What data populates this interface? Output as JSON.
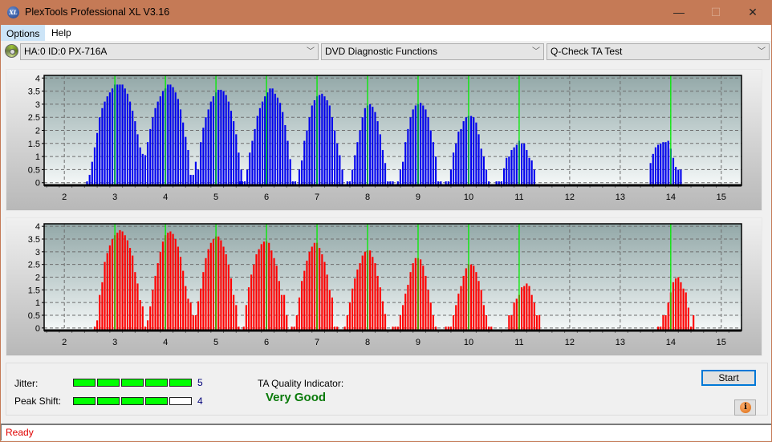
{
  "window": {
    "title": "PlexTools Professional XL V3.16",
    "app_icon_text": "XL",
    "minimize_glyph": "—",
    "maximize_glyph": "☐",
    "close_glyph": "✕"
  },
  "menu": {
    "items": [
      {
        "label": "Options"
      },
      {
        "label": "Help"
      }
    ]
  },
  "toolbar": {
    "drive_select": "HA:0 ID:0  PX-716A",
    "function_select": "DVD Diagnostic Functions",
    "test_select": "Q-Check TA Test",
    "chevron": "﹀"
  },
  "colors": {
    "top_bars": "#0000ee",
    "bottom_bars": "#ff0000",
    "marker": "#00ee00",
    "quality_text": "#0a7a0a"
  },
  "chart_data": [
    {
      "type": "bar",
      "name": "TA distribution (upper, land)",
      "xlim": [
        1.6,
        15.4
      ],
      "ylim": [
        -0.1,
        4.1
      ],
      "x_ticks": [
        2,
        3,
        4,
        5,
        6,
        7,
        8,
        9,
        10,
        11,
        12,
        13,
        14,
        15
      ],
      "y_ticks": [
        "0",
        "0.5",
        "1",
        "1.5",
        "2",
        "2.5",
        "3",
        "3.5",
        "4"
      ],
      "y_tick_values": [
        0,
        0.5,
        1,
        1.5,
        2,
        2.5,
        3,
        3.5,
        4
      ],
      "grid": true,
      "markers": [
        3,
        4,
        5,
        6,
        7,
        8,
        9,
        10,
        11,
        14
      ],
      "series_color": "#0000ee",
      "bar_step": 0.05,
      "segments": [
        {
          "x0": 2.45,
          "values": [
            0.05,
            0.3,
            0.8,
            1.35,
            1.9,
            2.5,
            2.85,
            3.1,
            3.3,
            3.45,
            3.6,
            3.75,
            3.75,
            3.75,
            3.75,
            3.6,
            3.4,
            3.1,
            2.75,
            2.35,
            1.85,
            1.35,
            1.1,
            1.05,
            1.55,
            2.05,
            2.5,
            2.85,
            3.1,
            3.3,
            3.5,
            3.6,
            3.75,
            3.75,
            3.65,
            3.45,
            3.2,
            2.8,
            2.3,
            1.75,
            1.25,
            0.3,
            0.3,
            0.8,
            0.5,
            1.55,
            2.1,
            2.5,
            2.8,
            3.1,
            3.3,
            3.45,
            3.55,
            3.55,
            3.5,
            3.35,
            3.1,
            2.75,
            2.35,
            1.85,
            1.15,
            0.5
          ]
        },
        {
          "x0": 5.47,
          "values": [
            0.05,
            0.05,
            0.05,
            0.5,
            1.15,
            1.6,
            2.05,
            2.55,
            2.85,
            3.1,
            3.3,
            3.45,
            3.6,
            3.6,
            3.4,
            3.25,
            3.05,
            2.7,
            2.2,
            1.6,
            0.9,
            0.05,
            0.05
          ]
        },
        {
          "x0": 6.65,
          "values": [
            0.5,
            0.85,
            1.6,
            2.0,
            2.5,
            2.95,
            3.15,
            3.3,
            3.35,
            3.4,
            3.3,
            3.15,
            2.95,
            2.5,
            2.0,
            1.5,
            1.05,
            0.5
          ]
        },
        {
          "x0": 7.6,
          "values": [
            0.05,
            0.05,
            0.5,
            1.05,
            1.55,
            2.0,
            2.5,
            2.85,
            2.95,
            3.0,
            2.9,
            2.7,
            2.35,
            1.85,
            1.25,
            0.75,
            0.05,
            0.05,
            0.05
          ]
        },
        {
          "x0": 8.6,
          "values": [
            0.05,
            0.5,
            0.8,
            1.55,
            2.05,
            2.5,
            2.8,
            2.95,
            3.0,
            3.05,
            2.95,
            2.8,
            2.5,
            2.0,
            1.55,
            1.0,
            0.05,
            0.05
          ]
        },
        {
          "x0": 9.55,
          "values": [
            0.05,
            0.05,
            0.5,
            1.15,
            1.5,
            1.95,
            2.05,
            2.35,
            2.5,
            2.55,
            2.55,
            2.5,
            2.3,
            1.85,
            1.3,
            1.0,
            0.5,
            0.05
          ]
        },
        {
          "x0": 10.55,
          "values": [
            0.05,
            0.05,
            0.05,
            0.55,
            0.95,
            1.0,
            1.25,
            1.35,
            1.45,
            1.6,
            1.5,
            1.5,
            1.25,
            0.95,
            0.85,
            0.5
          ]
        },
        {
          "x0": 13.6,
          "values": [
            0.75,
            1.1,
            1.35,
            1.45,
            1.5,
            1.55,
            1.55,
            1.6,
            1.3,
            0.95,
            0.6,
            0.5,
            0.5
          ]
        }
      ]
    },
    {
      "type": "bar",
      "name": "TA distribution (lower, groove)",
      "xlim": [
        1.6,
        15.4
      ],
      "ylim": [
        -0.1,
        4.1
      ],
      "x_ticks": [
        2,
        3,
        4,
        5,
        6,
        7,
        8,
        9,
        10,
        11,
        12,
        13,
        14,
        15
      ],
      "y_ticks": [
        "0",
        "0.5",
        "1",
        "1.5",
        "2",
        "2.5",
        "3",
        "3.5",
        "4"
      ],
      "y_tick_values": [
        0,
        0.5,
        1,
        1.5,
        2,
        2.5,
        3,
        3.5,
        4
      ],
      "grid": true,
      "markers": [
        3,
        4,
        5,
        6,
        7,
        8,
        9,
        10,
        11,
        14
      ],
      "series_color": "#ff0000",
      "bar_step": 0.05,
      "segments": [
        {
          "x0": 2.6,
          "values": [
            0.05,
            0.3,
            1.3,
            1.8,
            2.6,
            2.95,
            3.25,
            3.5,
            3.65,
            3.75,
            3.85,
            3.8,
            3.65,
            3.45,
            3.15,
            2.85,
            2.2,
            1.75,
            1.1,
            0.85,
            0.05,
            0.3,
            0.85,
            1.5,
            2.05,
            2.55,
            3.0,
            3.4,
            3.65,
            3.75,
            3.8,
            3.7,
            3.5,
            3.2,
            2.8,
            2.25,
            1.65,
            1.15,
            1.0,
            0.5,
            0.5,
            1.05,
            1.55,
            2.2,
            2.75,
            3.1,
            3.35,
            3.5,
            3.6,
            3.6,
            3.45,
            3.2,
            2.9,
            2.5,
            1.95,
            1.3,
            0.9,
            0.05
          ]
        },
        {
          "x0": 5.55,
          "values": [
            0.05,
            0.9,
            1.6,
            2.1,
            2.5,
            2.9,
            3.1,
            3.3,
            3.4,
            3.4,
            3.35,
            3.05,
            2.75,
            2.45,
            1.85,
            1.3,
            1.3,
            0.5
          ]
        },
        {
          "x0": 6.5,
          "values": [
            0.05,
            0.05,
            0.5,
            1.2,
            1.85,
            2.25,
            2.65,
            3.0,
            3.2,
            3.35,
            3.35,
            3.15,
            2.9,
            2.6,
            2.1,
            1.5,
            1.2,
            0.05,
            0.05
          ]
        },
        {
          "x0": 7.55,
          "values": [
            0.05,
            0.5,
            1.0,
            1.55,
            1.95,
            2.3,
            2.55,
            2.85,
            3.0,
            3.05,
            3.05,
            2.8,
            2.55,
            2.05,
            1.6,
            1.05,
            0.55
          ]
        },
        {
          "x0": 8.5,
          "values": [
            0.05,
            0.05,
            0.05,
            0.5,
            0.9,
            1.35,
            1.7,
            2.2,
            2.55,
            2.75,
            2.75,
            2.7,
            2.45,
            2.05,
            1.5,
            1.0,
            0.5,
            0.05
          ]
        },
        {
          "x0": 9.55,
          "values": [
            0.05,
            0.05,
            0.05,
            0.5,
            0.9,
            1.35,
            1.65,
            2.05,
            2.35,
            2.5,
            2.5,
            2.45,
            2.2,
            1.85,
            1.5,
            0.9,
            0.5,
            0.05,
            0.05
          ]
        },
        {
          "x0": 10.8,
          "values": [
            0.5,
            0.5,
            1.0,
            1.15,
            1.3,
            1.6,
            1.65,
            1.75,
            1.65,
            1.3,
            1.0,
            0.5,
            0.5
          ]
        },
        {
          "x0": 13.75,
          "values": [
            0.05,
            0.05,
            0.5,
            0.5,
            1.0,
            1.4,
            1.8,
            1.95,
            2.0,
            1.8,
            1.55,
            1.4,
            0.8,
            0.05,
            0.5
          ]
        }
      ]
    }
  ],
  "results": {
    "jitter_label": "Jitter:",
    "jitter_value": "5",
    "jitter_level": 5,
    "peak_shift_label": "Peak Shift:",
    "peak_shift_value": "4",
    "peak_shift_level": 4,
    "meter_max": 5,
    "ta_quality_label": "TA Quality Indicator:",
    "ta_quality_value": "Very Good"
  },
  "buttons": {
    "start": "Start",
    "info_glyph": "i"
  },
  "status": {
    "text": "Ready"
  }
}
